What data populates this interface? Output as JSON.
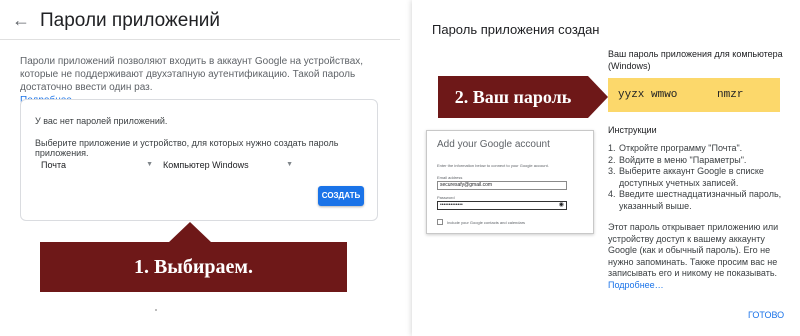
{
  "app_passwords": {
    "title": "Пароли приложений",
    "description": "Пароли приложений позволяют входить в аккаунт Google на устройствах, которые не поддерживают двухэтапную аутентификацию. Такой пароль достаточно ввести один раз.",
    "more_link": "Подробнее…",
    "no_passwords": "У вас нет паролей приложений.",
    "select_prompt": "Выберите приложение и устройство, для которых нужно создать пароль приложения.",
    "app_select": "Почта",
    "device_select": "Компьютер Windows",
    "create_button": "СОЗДАТЬ",
    "icons": {
      "back": "back-arrow-icon"
    }
  },
  "annotations": {
    "step1": "1. Выбираем.",
    "step2": "2. Ваш пароль"
  },
  "dialog": {
    "title": "Пароль приложения создан",
    "password_label": "Ваш пароль приложения для компьютера (Windows)",
    "password": "yyzx wmwo      nmzr",
    "instructions_title": "Инструкции",
    "instructions": [
      "Откройте программу \"Почта\".",
      "Войдите в меню \"Параметры\".",
      "Выберите аккаунт Google в списке доступных учетных записей.",
      "Введите шестнадцатизначный пароль, указанный выше."
    ],
    "info": "Этот пароль открывает приложению или устройству доступ к вашему аккаунту Google (как и обычный пароль). Его не нужно запоминать. Также просим вас не записывать его и никому не показывать.",
    "more_link": "Подробнее…",
    "done_button": "ГОТОВО",
    "highlight_color": "#fcd86b"
  },
  "google_window": {
    "title": "Add your Google account",
    "info": "Enter the information below to connect to your Google account.",
    "email_label": "Email address",
    "email_value": "securesafy@gmail.com",
    "password_label": "Password",
    "password_value": "•••••••••••••",
    "checkbox_label": "Include your Google contacts and calendars"
  },
  "colors": {
    "banner": "#6e1818",
    "accent": "#1a73e8"
  }
}
